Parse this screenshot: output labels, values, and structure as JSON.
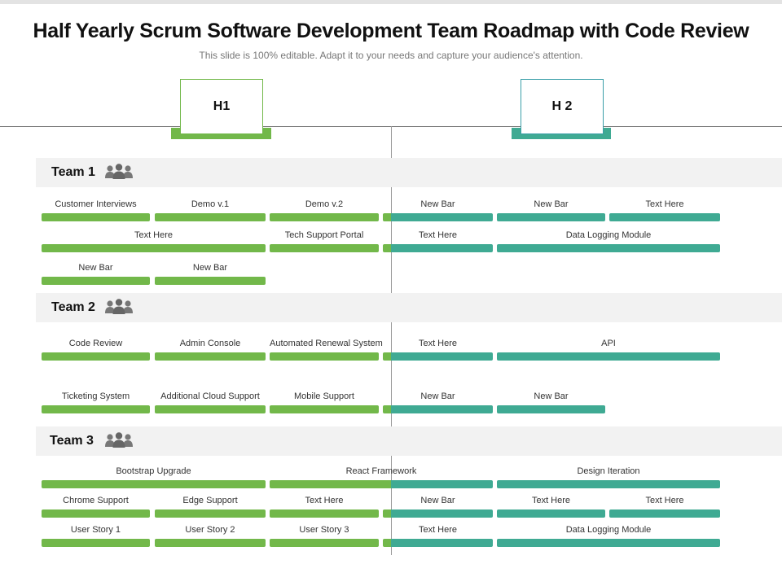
{
  "title": "Half Yearly Scrum Software Development Team Roadmap with Code Review",
  "subtitle": "This slide is 100% editable. Adapt it to your needs and capture your audience's attention.",
  "colors": {
    "h1": "#72b84a",
    "h2": "#3faa93",
    "h1_border": "#72b84a",
    "h2_border": "#3a9fa8"
  },
  "halves": [
    "H1",
    "H 2"
  ],
  "teams": [
    {
      "name": "Team 1",
      "rows": [
        [
          {
            "label": "Customer Interviews",
            "start": 0,
            "span": 1
          },
          {
            "label": "Demo v.1",
            "start": 1,
            "span": 1
          },
          {
            "label": "Demo v.2",
            "start": 2,
            "span": 1
          },
          {
            "label": "New Bar",
            "start": 3,
            "span": 1
          },
          {
            "label": "New Bar",
            "start": 4,
            "span": 1
          },
          {
            "label": "Text Here",
            "start": 5,
            "span": 1
          }
        ],
        [
          {
            "label": "Text Here",
            "start": 0,
            "span": 2
          },
          {
            "label": "Tech Support Portal",
            "start": 2,
            "span": 1
          },
          {
            "label": "Text Here",
            "start": 3,
            "span": 1
          },
          {
            "label": "Data Logging Module",
            "start": 4,
            "span": 2
          }
        ],
        [
          {
            "label": "New Bar",
            "start": 0,
            "span": 1
          },
          {
            "label": "New Bar",
            "start": 1,
            "span": 1
          }
        ]
      ]
    },
    {
      "name": "Team 2",
      "rows": [
        [
          {
            "label": "Code Review",
            "start": 0,
            "span": 1
          },
          {
            "label": "Admin Console",
            "start": 1,
            "span": 1
          },
          {
            "label": "Automated Renewal System",
            "start": 2,
            "span": 1
          },
          {
            "label": "Text Here",
            "start": 3,
            "span": 1
          },
          {
            "label": "API",
            "start": 4,
            "span": 2
          }
        ],
        [
          {
            "label": "Ticketing System",
            "start": 0,
            "span": 1
          },
          {
            "label": "Additional Cloud Support",
            "start": 1,
            "span": 1
          },
          {
            "label": "Mobile Support",
            "start": 2,
            "span": 1
          },
          {
            "label": "New Bar",
            "start": 3,
            "span": 1
          },
          {
            "label": "New Bar",
            "start": 4,
            "span": 1
          }
        ]
      ]
    },
    {
      "name": "Team 3",
      "rows": [
        [
          {
            "label": "Bootstrap Upgrade",
            "start": 0,
            "span": 2
          },
          {
            "label": "React Framework",
            "start": 2,
            "span": 2
          },
          {
            "label": "Design Iteration",
            "start": 4,
            "span": 2
          }
        ],
        [
          {
            "label": "Chrome Support",
            "start": 0,
            "span": 1
          },
          {
            "label": "Edge Support",
            "start": 1,
            "span": 1
          },
          {
            "label": "Text Here",
            "start": 2,
            "span": 1
          },
          {
            "label": "New Bar",
            "start": 3,
            "span": 1
          },
          {
            "label": "Text Here",
            "start": 4,
            "span": 1
          },
          {
            "label": "Text Here",
            "start": 5,
            "span": 1
          }
        ],
        [
          {
            "label": "User Story 1",
            "start": 0,
            "span": 1
          },
          {
            "label": "User Story 2",
            "start": 1,
            "span": 1
          },
          {
            "label": "User Story 3",
            "start": 2,
            "span": 1
          },
          {
            "label": "Text Here",
            "start": 3,
            "span": 1
          },
          {
            "label": "Data Logging Module",
            "start": 4,
            "span": 2
          }
        ]
      ]
    }
  ]
}
